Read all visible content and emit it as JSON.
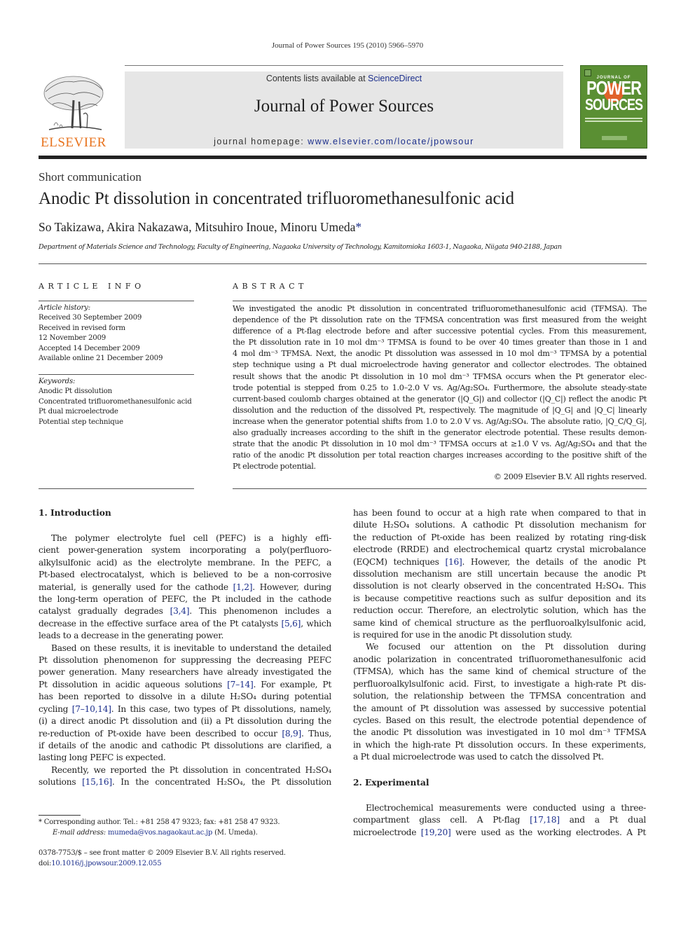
{
  "running_head": "Journal of Power Sources 195 (2010) 5966–5970",
  "masthead": {
    "contents_prefix": "Contents lists available at ",
    "contents_link": "ScienceDirect",
    "journal_name": "Journal of Power Sources",
    "homepage_prefix": "journal homepage: ",
    "homepage_link": "www.elsevier.com/locate/jpowsour",
    "publisher_logo_text": "ELSEVIER",
    "cover": {
      "journal_of": "JOURNAL OF",
      "power": "POWER",
      "sources": "SOURCES",
      "color": "#5a8f33"
    }
  },
  "article": {
    "type": "Short communication",
    "title": "Anodic Pt dissolution in concentrated trifluoromethanesulfonic acid",
    "authors": "So Takizawa, Akira Nakazawa, Mitsuhiro Inoue, Minoru Umeda",
    "corresponding_mark": "*",
    "affiliation": "Department of Materials Science and Technology, Faculty of Engineering, Nagaoka University of Technology, Kamitomioka 1603-1, Nagaoka, Niigata 940-2188, Japan"
  },
  "article_info": {
    "heading": "ARTICLE INFO",
    "history_label": "Article history:",
    "history": [
      "Received 30 September 2009",
      "Received in revised form",
      "12 November 2009",
      "Accepted 14 December 2009",
      "Available online 21 December 2009"
    ],
    "keywords_label": "Keywords:",
    "keywords": [
      "Anodic Pt dissolution",
      "Concentrated trifluoromethanesulfonic acid",
      "Pt dual microelectrode",
      "Potential step technique"
    ]
  },
  "abstract": {
    "heading": "ABSTRACT",
    "lines": [
      "We investigated the anodic Pt dissolution in concentrated trifluoromethanesulfonic acid (TFMSA). The",
      "dependence of the Pt dissolution rate on the TFMSA concentration was first measured from the weight",
      "difference of a Pt-flag electrode before and after successive potential cycles. From this measurement,",
      "the Pt dissolution rate in 10 mol dm⁻³ TFMSA is found to be over 40 times greater than those in 1 and",
      "4 mol dm⁻³ TFMSA. Next, the anodic Pt dissolution was assessed in 10 mol dm⁻³ TFMSA by a potential",
      "step technique using a Pt dual microelectrode having generator and collector electrodes. The obtained",
      "result shows that the anodic Pt dissolution in 10 mol dm⁻³ TFMSA occurs when the Pt generator elec-",
      "trode potential is stepped from 0.25 to 1.0–2.0 V vs. Ag/Ag₂SO₄. Furthermore, the absolute steady-state",
      "current-based coulomb charges obtained at the generator (|Q_G|) and collector (|Q_C|) reflect the anodic Pt",
      "dissolution and the reduction of the dissolved Pt, respectively. The magnitude of |Q_G| and |Q_C| linearly",
      "increase when the generator potential shifts from 1.0 to 2.0 V vs. Ag/Ag₂SO₄. The absolute ratio, |Q_C/Q_G|,",
      "also gradually increases according to the shift in the generator electrode potential. These results demon-",
      "strate that the anodic Pt dissolution in 10 mol dm⁻³ TFMSA occurs at ≥1.0 V vs. Ag/Ag₂SO₄ and that the",
      "ratio of the anodic Pt dissolution per total reaction charges increases according to the positive shift of the",
      "Pt electrode potential."
    ],
    "copyright": "© 2009 Elsevier B.V. All rights reserved."
  },
  "sections": {
    "introduction": {
      "heading": "1.  Introduction",
      "left_lines": [
        {
          "t": "The polymer electrolyte fuel cell (PEFC) is a highly effi-",
          "ind": true
        },
        {
          "t": "cient power-generation system incorporating a poly(perfluoro-"
        },
        {
          "t": "alkylsulfonic acid) as the electrolyte membrane. In the PEFC, a"
        },
        {
          "t": "Pt-based electrocatalyst, which is believed to be a non-corrosive"
        },
        {
          "t": "material, is generally used for the cathode [1,2]. However, during"
        },
        {
          "t": "the long-term operation of PEFC, the Pt included in the cathode"
        },
        {
          "t": "catalyst gradually degrades [3,4]. This phenomenon includes a"
        },
        {
          "t": "decrease in the effective surface area of the Pt catalysts [5,6], which"
        },
        {
          "t": "leads to a decrease in the generating power.",
          "last": true
        },
        {
          "t": "Based on these results, it is inevitable to understand the detailed",
          "ind": true
        },
        {
          "t": "Pt dissolution phenomenon for suppressing the decreasing PEFC"
        },
        {
          "t": "power generation. Many researchers have already investigated the"
        },
        {
          "t": "Pt dissolution in acidic aqueous solutions [7–14]. For example, Pt"
        },
        {
          "t": "has been reported to dissolve in a dilute H₂SO₄ during potential"
        },
        {
          "t": "cycling [7–10,14]. In this case, two types of Pt dissolutions, namely,"
        },
        {
          "t": "(i) a direct anodic Pt dissolution and (ii) a Pt dissolution during the"
        },
        {
          "t": "re-reduction of Pt-oxide have been described to occur [8,9]. Thus,"
        },
        {
          "t": "if details of the anodic and cathodic Pt dissolutions are clarified, a"
        },
        {
          "t": "lasting long PEFC is expected.",
          "last": true
        },
        {
          "t": "Recently, we reported the Pt dissolution in concentrated H₂SO₄",
          "ind": true
        },
        {
          "t": "solutions [15,16]. In the concentrated H₂SO₄, the Pt dissolution"
        }
      ],
      "right_lines": [
        {
          "t": "has been found to occur at a high rate when compared to that in"
        },
        {
          "t": "dilute H₂SO₄ solutions. A cathodic Pt dissolution mechanism for"
        },
        {
          "t": "the reduction of Pt-oxide has been realized by rotating ring-disk"
        },
        {
          "t": "electrode (RRDE) and electrochemical quartz crystal microbalance"
        },
        {
          "t": "(EQCM) techniques [16]. However, the details of the anodic Pt"
        },
        {
          "t": "dissolution mechanism are still uncertain because the anodic Pt"
        },
        {
          "t": "dissolution is not clearly observed in the concentrated H₂SO₄. This"
        },
        {
          "t": "is because competitive reactions such as sulfur deposition and its"
        },
        {
          "t": "reduction occur. Therefore, an electrolytic solution, which has the"
        },
        {
          "t": "same kind of chemical structure as the perfluoroalkylsulfonic acid,"
        },
        {
          "t": "is required for use in the anodic Pt dissolution study.",
          "last": true
        },
        {
          "t": "We focused our attention on the Pt dissolution during",
          "ind": true
        },
        {
          "t": "anodic polarization in concentrated trifluoromethanesulfonic acid"
        },
        {
          "t": "(TFMSA), which has the same kind of chemical structure of the"
        },
        {
          "t": "perfluoroalkylsulfonic acid. First, to investigate a high-rate Pt dis-"
        },
        {
          "t": "solution, the relationship between the TFMSA concentration and"
        },
        {
          "t": "the amount of Pt dissolution was assessed by successive potential"
        },
        {
          "t": "cycles. Based on this result, the electrode potential dependence of"
        },
        {
          "t": "the anodic Pt dissolution was investigated in 10 mol dm⁻³ TFMSA"
        },
        {
          "t": "in which the high-rate Pt dissolution occurs. In these experiments,"
        },
        {
          "t": "a Pt dual microelectrode was used to catch the dissolved Pt.",
          "last": true
        }
      ]
    },
    "experimental": {
      "heading": "2.  Experimental",
      "lines": [
        {
          "t": "Electrochemical measurements were conducted using a three-",
          "ind": true
        },
        {
          "t": "compartment glass cell. A Pt-flag [17,18] and a Pt dual"
        },
        {
          "t": "microelectrode [19,20] were used as the working electrodes. A Pt"
        }
      ]
    }
  },
  "footnote": {
    "corresponding": "*  Corresponding author. Tel.: +81 258 47 9323; fax: +81 258 47 9323.",
    "email_label": "E-mail address: ",
    "email": "mumeda@vos.nagaokaut.ac.jp",
    "email_suffix": " (M. Umeda).",
    "front_matter": "0378-7753/$ – see front matter © 2009 Elsevier B.V. All rights reserved.",
    "doi_prefix": "doi:",
    "doi": "10.1016/j.jpowsour.2009.12.055"
  }
}
